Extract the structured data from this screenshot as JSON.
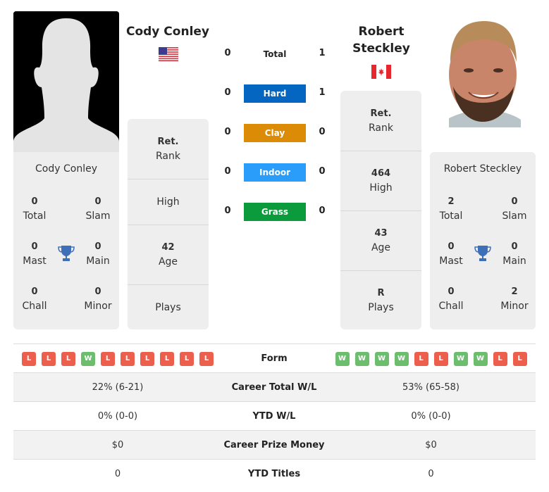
{
  "colors": {
    "hard": "#0466c1",
    "clay": "#dc8b06",
    "indoor": "#2a9dfa",
    "grass": "#0b9b3c",
    "win": "#6dbd6f",
    "loss": "#ec5f4d",
    "trophy": "#3e6fb9"
  },
  "player1": {
    "name": "Cody Conley",
    "country": "USA",
    "flag_icon": "us-flag-icon",
    "card_name": "Cody Conley",
    "titles": {
      "total": "0",
      "total_label": "Total",
      "slam": "0",
      "slam_label": "Slam",
      "mast": "0",
      "mast_label": "Mast",
      "main": "0",
      "main_label": "Main",
      "chall": "0",
      "chall_label": "Chall",
      "minor": "0",
      "minor_label": "Minor"
    },
    "info": {
      "rank_value": "Ret.",
      "rank_label": "Rank",
      "high_value": "",
      "high_label": "High",
      "age_value": "42",
      "age_label": "Age",
      "plays_value": "",
      "plays_label": "Plays"
    }
  },
  "player2": {
    "name_line1": "Robert",
    "name_line2": "Steckley",
    "country": "Canada",
    "flag_icon": "canada-flag-icon",
    "card_name": "Robert Steckley",
    "titles": {
      "total": "2",
      "total_label": "Total",
      "slam": "0",
      "slam_label": "Slam",
      "mast": "0",
      "mast_label": "Mast",
      "main": "0",
      "main_label": "Main",
      "chall": "0",
      "chall_label": "Chall",
      "minor": "2",
      "minor_label": "Minor"
    },
    "info": {
      "rank_value": "Ret.",
      "rank_label": "Rank",
      "high_value": "464",
      "high_label": "High",
      "age_value": "43",
      "age_label": "Age",
      "plays_value": "R",
      "plays_label": "Plays"
    }
  },
  "h2h": {
    "total_label": "Total",
    "total": {
      "p1": "0",
      "p2": "1"
    },
    "surfaces": [
      {
        "label": "Hard",
        "p1": "0",
        "p2": "1"
      },
      {
        "label": "Clay",
        "p1": "0",
        "p2": "0"
      },
      {
        "label": "Indoor",
        "p1": "0",
        "p2": "0"
      },
      {
        "label": "Grass",
        "p1": "0",
        "p2": "0"
      }
    ]
  },
  "comparison": {
    "form_label": "Form",
    "p1_form": [
      "L",
      "L",
      "L",
      "W",
      "L",
      "L",
      "L",
      "L",
      "L",
      "L"
    ],
    "p2_form": [
      "W",
      "W",
      "W",
      "W",
      "L",
      "L",
      "W",
      "W",
      "L",
      "L"
    ],
    "rows": [
      {
        "label": "Career Total W/L",
        "p1": "22% (6-21)",
        "p2": "53% (65-58)"
      },
      {
        "label": "YTD W/L",
        "p1": "0% (0-0)",
        "p2": "0% (0-0)"
      },
      {
        "label": "Career Prize Money",
        "p1": "$0",
        "p2": "$0"
      },
      {
        "label": "YTD Titles",
        "p1": "0",
        "p2": "0"
      }
    ]
  }
}
